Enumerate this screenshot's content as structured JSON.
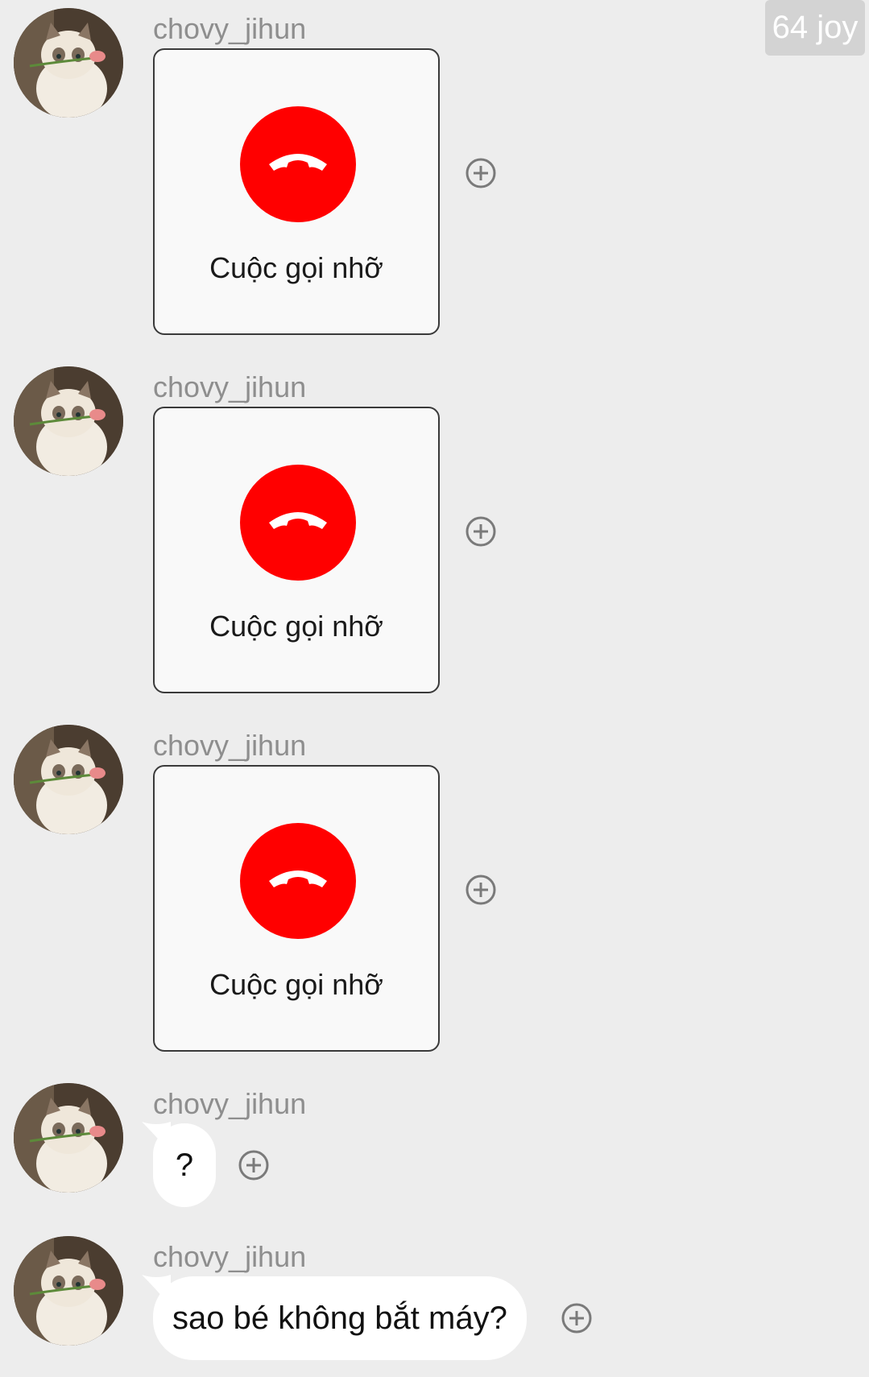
{
  "badge": {
    "text": "64 joy"
  },
  "messages": [
    {
      "sender": "chovy_jihun",
      "type": "call",
      "label": "Cuộc gọi nhỡ"
    },
    {
      "sender": "chovy_jihun",
      "type": "call",
      "label": "Cuộc gọi nhỡ"
    },
    {
      "sender": "chovy_jihun",
      "type": "call",
      "label": "Cuộc gọi nhỡ"
    },
    {
      "sender": "chovy_jihun",
      "type": "text",
      "text": "?"
    },
    {
      "sender": "chovy_jihun",
      "type": "text",
      "text": "sao bé không bắt máy?"
    }
  ],
  "icons": {
    "missed_call": "phone-hangup-icon",
    "react": "plus-circle-icon",
    "avatar": "cat-with-rose-avatar"
  },
  "colors": {
    "background": "#ededed",
    "missed_call": "#ff0000",
    "bubble": "#ffffff",
    "sender": "#8e8e8e"
  }
}
